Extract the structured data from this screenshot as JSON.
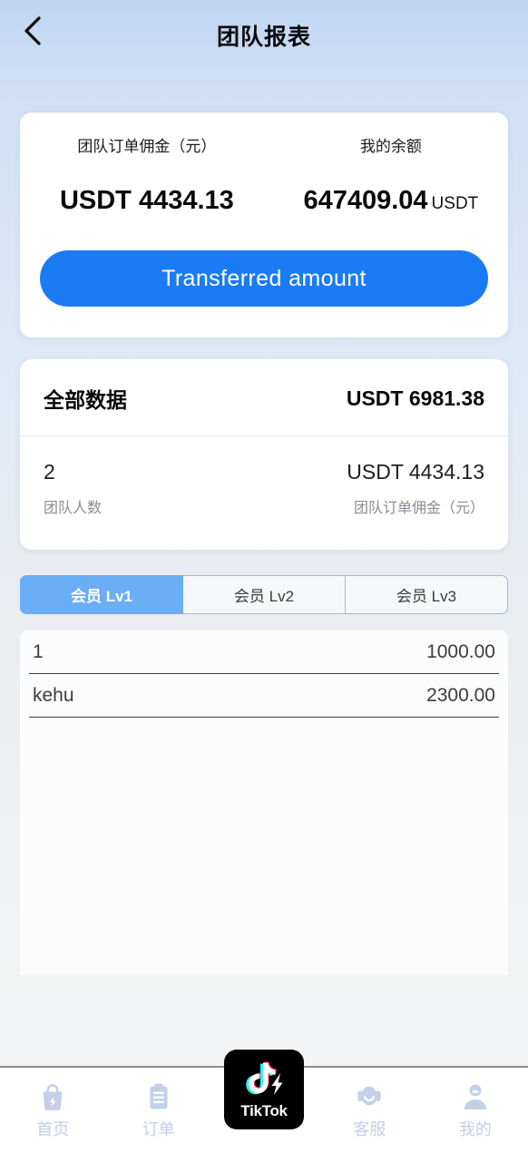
{
  "header": {
    "title": "团队报表",
    "back_icon": "chevron-left-icon"
  },
  "summary": {
    "commission": {
      "label": "团队订单佣金（元）",
      "value": "USDT 4434.13"
    },
    "balance": {
      "label": "我的余额",
      "value": "647409.04",
      "unit": "USDT"
    },
    "transfer_button": "Transferred amount",
    "accent_color": "#1b7bf5"
  },
  "all_data": {
    "title": "全部数据",
    "total": "USDT 6981.38",
    "stats": [
      {
        "value": "2",
        "label": "团队人数"
      },
      {
        "value": "USDT 4434.13",
        "label": "团队订单佣金（元）"
      }
    ]
  },
  "tabs": {
    "active_index": 0,
    "items": [
      {
        "label": "会员 Lv1"
      },
      {
        "label": "会员 Lv2"
      },
      {
        "label": "会员 Lv3"
      }
    ],
    "active_color": "#6aaef5",
    "border_color": "#8fbdf3"
  },
  "member_list": [
    {
      "name": "1",
      "amount": "1000.00"
    },
    {
      "name": "kehu",
      "amount": "2300.00"
    }
  ],
  "bottom_nav": {
    "icon_color": "#c3d0e8",
    "items": [
      {
        "label": "首页",
        "icon": "shopping-bag-bolt-icon"
      },
      {
        "label": "订单",
        "icon": "clipboard-icon"
      },
      {
        "label": "TikTok",
        "icon": "tiktok-logo-icon"
      },
      {
        "label": "客服",
        "icon": "headset-icon"
      },
      {
        "label": "我的",
        "icon": "person-icon"
      }
    ]
  }
}
